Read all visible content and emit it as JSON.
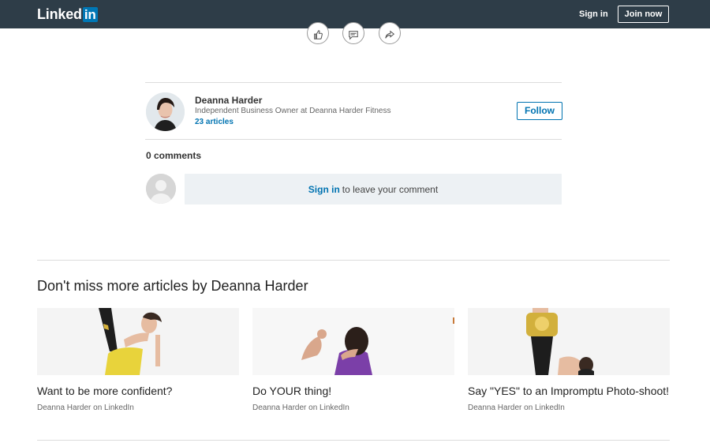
{
  "header": {
    "logo_text": "Linked",
    "logo_in": "in",
    "signin_label": "Sign in",
    "join_label": "Join now"
  },
  "actions": [
    "thumbs-up-icon",
    "comment-icon",
    "share-icon"
  ],
  "author": {
    "name": "Deanna Harder",
    "headline": "Independent Business Owner at Deanna Harder Fitness",
    "articles": "23 articles",
    "follow_label": "Follow"
  },
  "comments": {
    "count": "0 comments",
    "signin_link": "Sign in",
    "prompt": "to leave your comment"
  },
  "more": {
    "title": "Don't miss more articles by Deanna Harder",
    "cards": [
      {
        "title": "Want to be more confident?",
        "meta": "Deanna Harder on LinkedIn"
      },
      {
        "title": "Do YOUR thing!",
        "meta": "Deanna Harder on LinkedIn"
      },
      {
        "title": "Say \"YES\" to an Impromptu Photo-shoot!",
        "meta": "Deanna Harder on LinkedIn"
      }
    ]
  },
  "colors": {
    "header_bg": "#2e3d48",
    "accent": "#0073b1",
    "comment_box_bg": "#edf1f4"
  }
}
